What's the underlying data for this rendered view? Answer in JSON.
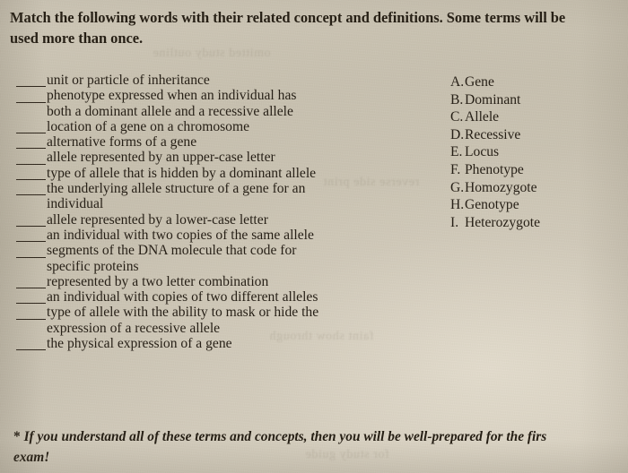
{
  "worksheet": {
    "prompt_line1": "Match the following words with their related concept and definitions. Some terms will be",
    "prompt_line2": "used more than once.",
    "definitions": [
      {
        "blank": true,
        "text": "unit or particle of inheritance"
      },
      {
        "blank": true,
        "text": "phenotype expressed when an individual has"
      },
      {
        "blank": false,
        "text": "both a dominant allele and a recessive allele"
      },
      {
        "blank": true,
        "text": "location of a gene on a chromosome"
      },
      {
        "blank": true,
        "text": "alternative forms of a gene"
      },
      {
        "blank": true,
        "text": "allele represented by an upper-case letter"
      },
      {
        "blank": true,
        "text": "type of allele that is hidden by a dominant allele"
      },
      {
        "blank": true,
        "text": "the underlying allele structure of a gene for an"
      },
      {
        "blank": false,
        "text": "individual"
      },
      {
        "blank": true,
        "text": "allele represented by a lower-case letter"
      },
      {
        "blank": true,
        "text": "an individual with two copies of the same allele"
      },
      {
        "blank": true,
        "text": "segments of the DNA molecule that code for"
      },
      {
        "blank": false,
        "text": "specific proteins"
      },
      {
        "blank": true,
        "text": "represented by a two letter combination"
      },
      {
        "blank": true,
        "text": "an individual with copies of two different alleles"
      },
      {
        "blank": true,
        "text": "type of allele with the ability to mask or hide the"
      },
      {
        "blank": false,
        "text": "expression of a recessive allele"
      },
      {
        "blank": true,
        "text": "the physical expression of a gene"
      }
    ],
    "answers": [
      {
        "letter": "A.",
        "term": "Gene"
      },
      {
        "letter": "B.",
        "term": "Dominant"
      },
      {
        "letter": "C.",
        "term": "Allele"
      },
      {
        "letter": "D.",
        "term": "Recessive"
      },
      {
        "letter": "E.",
        "term": "Locus"
      },
      {
        "letter": "F.",
        "term": "Phenotype"
      },
      {
        "letter": "G.",
        "term": "Homozygote"
      },
      {
        "letter": "H.",
        "term": "Genotype"
      },
      {
        "letter": "I.",
        "term": "Heterozygote"
      }
    ],
    "footnote": {
      "marker": "*",
      "line1": "If you understand all of these terms and concepts, then you will be well-prepared for the firs",
      "line2": "exam!"
    }
  }
}
